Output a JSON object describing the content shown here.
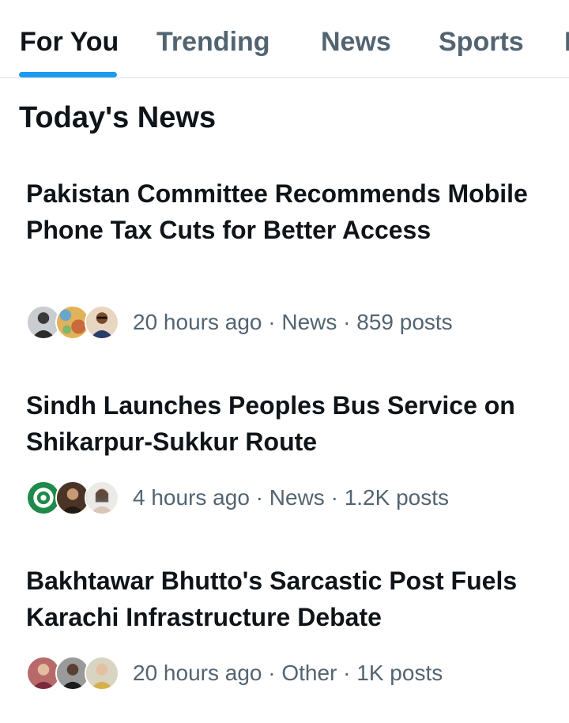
{
  "tabs": [
    {
      "label": "For You",
      "active": true
    },
    {
      "label": "Trending",
      "active": false
    },
    {
      "label": "News",
      "active": false
    },
    {
      "label": "Sports",
      "active": false
    },
    {
      "label": "E",
      "active": false
    }
  ],
  "section": {
    "title": "Today's News"
  },
  "news": [
    {
      "headline": "Pakistan Committee Recommends Mobile Phone Tax Cuts for Better Access",
      "time": "20 hours ago",
      "category": "News",
      "posts": "859 posts",
      "avatars": [
        "man-avatar",
        "colorful-art-avatar",
        "man-avatar"
      ]
    },
    {
      "headline": "Sindh Launches Peoples Bus Service on Shikarpur-Sukkur Route",
      "time": "4 hours ago",
      "category": "News",
      "posts": "1.2K posts",
      "avatars": [
        "government-seal-avatar",
        "man-avatar",
        "woman-avatar"
      ]
    },
    {
      "headline": "Bakhtawar Bhutto's Sarcastic Post Fuels Karachi Infrastructure Debate",
      "time": "20 hours ago",
      "category": "Other",
      "posts": "1K posts",
      "avatars": [
        "woman-avatar",
        "man-avatar",
        "woman-avatar"
      ]
    }
  ],
  "colors": {
    "accent": "#1d9bf0",
    "text": "#0f1419",
    "secondary": "#536471",
    "divider": "#dde1e4"
  }
}
